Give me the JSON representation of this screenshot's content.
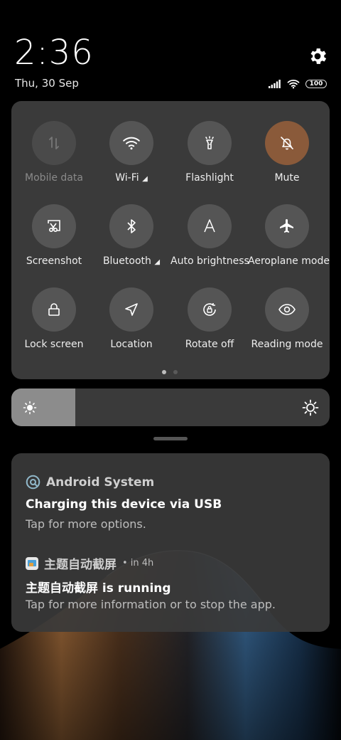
{
  "header": {
    "time": "2:36",
    "date": "Thu, 30 Sep",
    "battery": "100"
  },
  "icons": {
    "settings": "gear-icon",
    "signal": "signal-icon",
    "wifi": "wifi-icon",
    "battery": "battery-icon"
  },
  "tiles": [
    {
      "label": "Mobile data",
      "icon": "mobile-data-icon",
      "state": "disabled"
    },
    {
      "label": "Wi-Fi",
      "icon": "wifi-icon",
      "state": "off"
    },
    {
      "label": "Flashlight",
      "icon": "flashlight-icon",
      "state": "off"
    },
    {
      "label": "Mute",
      "icon": "bell-off-icon",
      "state": "on"
    },
    {
      "label": "Screenshot",
      "icon": "screenshot-icon",
      "state": "off"
    },
    {
      "label": "Bluetooth",
      "icon": "bluetooth-icon",
      "state": "off"
    },
    {
      "label": "Auto brightness",
      "icon": "auto-brightness-icon",
      "state": "off"
    },
    {
      "label": "Aeroplane mode",
      "icon": "airplane-icon",
      "state": "off"
    },
    {
      "label": "Lock screen",
      "icon": "lock-icon",
      "state": "off"
    },
    {
      "label": "Location",
      "icon": "location-icon",
      "state": "off"
    },
    {
      "label": "Rotate off",
      "icon": "rotate-lock-icon",
      "state": "off"
    },
    {
      "label": "Reading mode",
      "icon": "eye-icon",
      "state": "off"
    }
  ],
  "pager": {
    "pages": 2,
    "current": 1
  },
  "brightness": {
    "level": 0.2
  },
  "notifications": [
    {
      "app": "Android System",
      "title": "Charging this device via USB",
      "body": "Tap for more options."
    },
    {
      "app": "主题自动截屏",
      "time": "• in 4h",
      "title": "主题自动截屏 is running",
      "body": "Tap for more information or to stop the app."
    }
  ],
  "colors": {
    "panel": "#3a3a3a",
    "tile": "#555555",
    "active_tile": "#8a5a3a",
    "brightness_fill": "#8c8c8c"
  }
}
